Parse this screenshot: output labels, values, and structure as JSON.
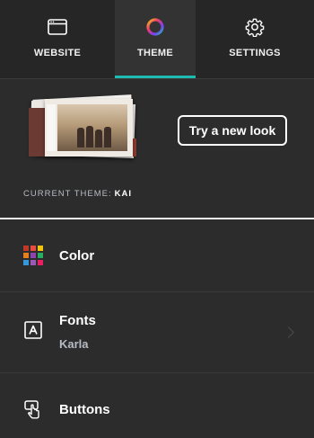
{
  "tabs": [
    {
      "id": "website",
      "label": "WEBSITE",
      "icon": "browser-window-icon"
    },
    {
      "id": "theme",
      "label": "THEME",
      "icon": "color-wheel-icon",
      "active": true
    },
    {
      "id": "settings",
      "label": "SETTINGS",
      "icon": "gear-icon"
    }
  ],
  "preview": {
    "try_button_label": "Try a new look",
    "current_theme_label": "CURRENT THEME:",
    "current_theme_name": "KAI"
  },
  "menu": [
    {
      "id": "color",
      "title": "Color",
      "icon": "color-swatches-icon"
    },
    {
      "id": "fonts",
      "title": "Fonts",
      "subtitle": "Karla",
      "icon": "font-box-icon"
    },
    {
      "id": "buttons",
      "title": "Buttons",
      "icon": "button-tap-icon"
    }
  ],
  "colors": {
    "background": "#2c2c2c",
    "tab_bar": "#262626",
    "active_tab": "#333333",
    "accent": "#1fbab1",
    "swatches": [
      "#c0392b",
      "#e74c3c",
      "#f1c40f",
      "#e67e22",
      "#8e44ad",
      "#27ae60",
      "#3498db",
      "#9b59b6",
      "#e91e63"
    ]
  }
}
